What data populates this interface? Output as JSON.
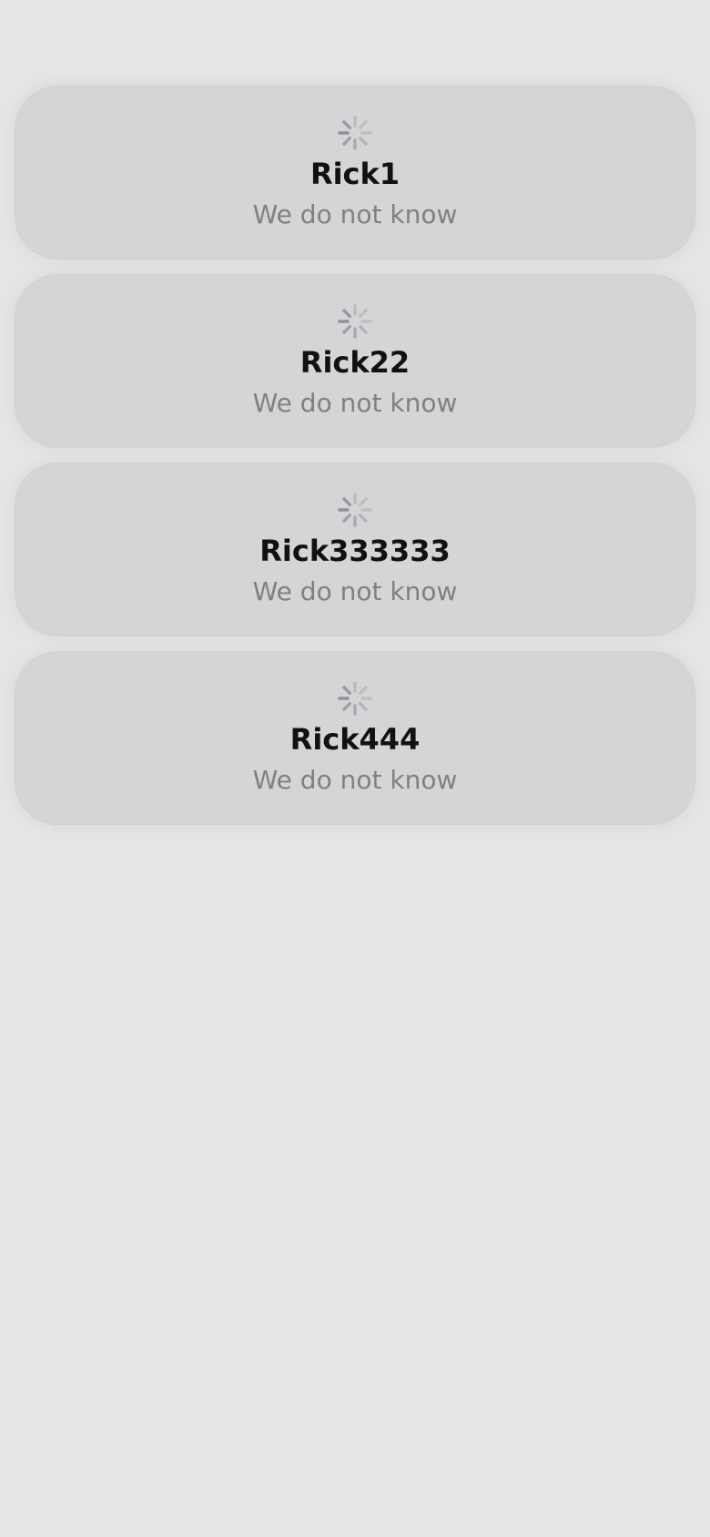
{
  "items": [
    {
      "name": "Rick1",
      "status": "We do not know",
      "icon": "loading-spinner-icon"
    },
    {
      "name": "Rick22",
      "status": "We do not know",
      "icon": "loading-spinner-icon"
    },
    {
      "name": "Rick333333",
      "status": "We do not know",
      "icon": "loading-spinner-icon"
    },
    {
      "name": "Rick444",
      "status": "We do not know",
      "icon": "loading-spinner-icon"
    }
  ],
  "colors": {
    "background": "#e5e5e7",
    "card": "#d5d5d7",
    "title": "#111111",
    "subtitle": "#808083",
    "spinner": "#8e8e93"
  }
}
